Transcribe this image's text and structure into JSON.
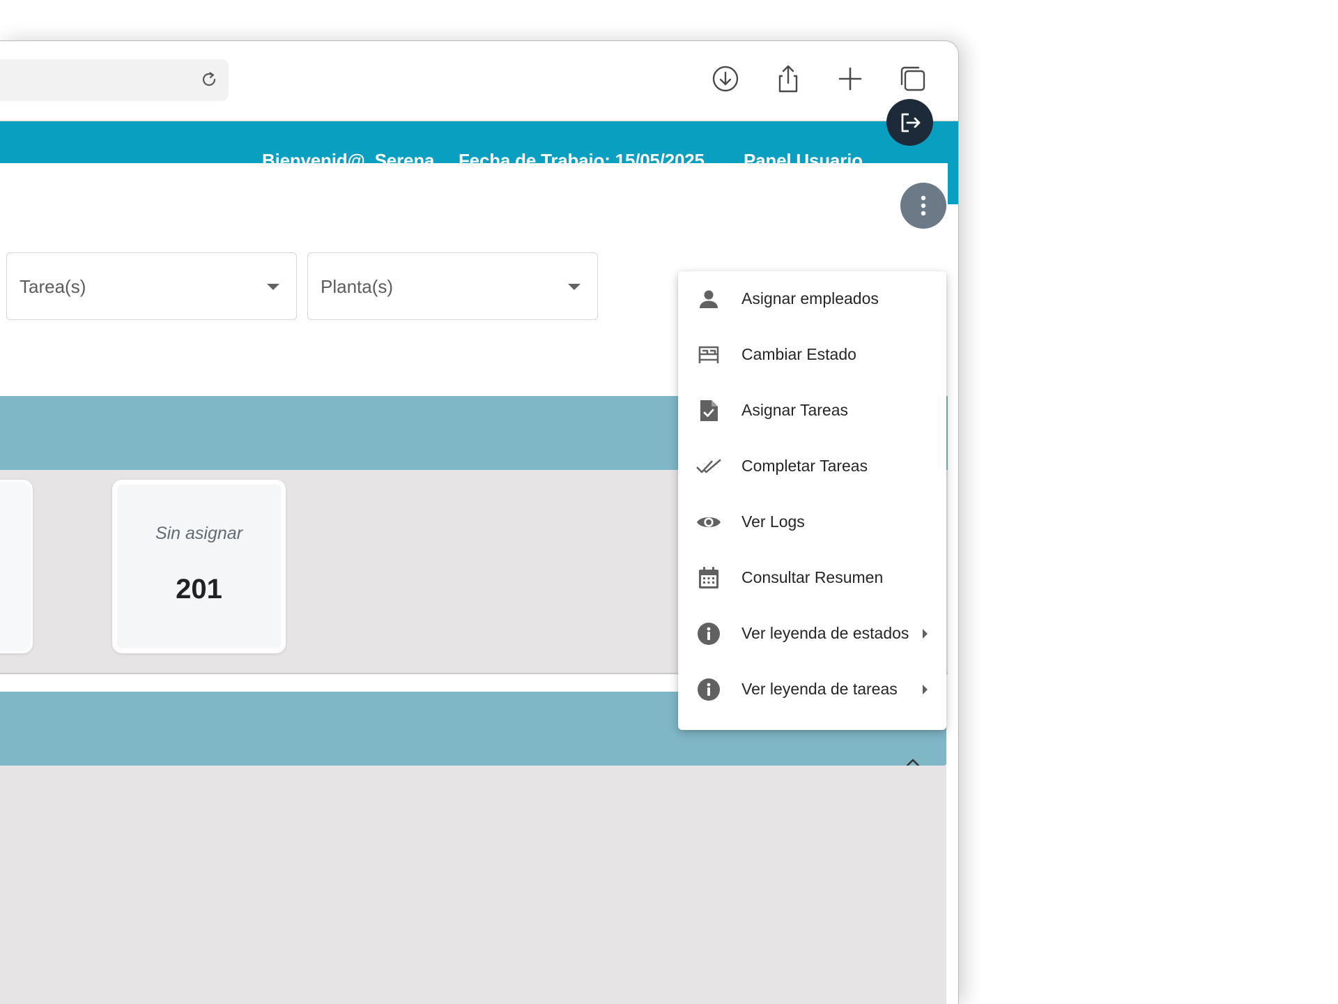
{
  "header": {
    "welcome": "Bienvenid@, Serena",
    "work_date": "Fecha de Trabajo: 15/05/2025",
    "user_panel": "Panel Usuario"
  },
  "filters": {
    "tasks_placeholder": "Tarea(s)",
    "plant_placeholder": "Planta(s)"
  },
  "summary_card": {
    "title": "Sin asignar",
    "value": "201"
  },
  "menu": {
    "items": [
      {
        "label": "Asignar empleados",
        "icon": "person-icon"
      },
      {
        "label": "Cambiar Estado",
        "icon": "bed-icon"
      },
      {
        "label": "Asignar Tareas",
        "icon": "document-check-icon"
      },
      {
        "label": "Completar Tareas",
        "icon": "double-check-icon"
      },
      {
        "label": "Ver Logs",
        "icon": "eye-icon"
      },
      {
        "label": "Consultar Resumen",
        "icon": "calendar-icon"
      },
      {
        "label": "Ver leyenda de estados",
        "icon": "info-icon",
        "submenu": true
      },
      {
        "label": "Ver leyenda de tareas",
        "icon": "info-icon",
        "submenu": true
      }
    ]
  },
  "colors": {
    "header": "#099fc1",
    "band": "#80b7c7",
    "panel_bg": "#e6e4e5",
    "logout_bg": "#1c2a39",
    "kebab_bg": "#6c7a87"
  }
}
